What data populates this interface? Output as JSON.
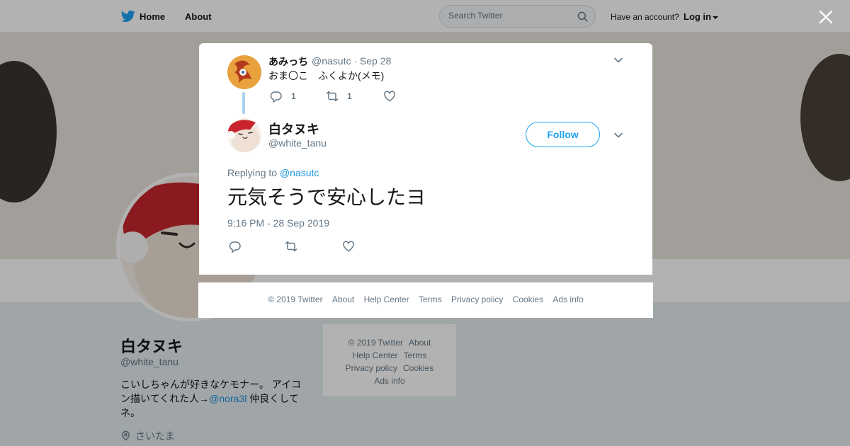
{
  "topbar": {
    "home_label": "Home",
    "about_label": "About",
    "search_placeholder": "Search Twitter",
    "have_account": "Have an account?",
    "login_label": "Log in"
  },
  "profile": {
    "name": "白タヌキ",
    "handle": "@white_tanu",
    "bio_before": "こいしちゃんが好きなケモナー。 アイコン描いてくれた人→",
    "bio_link": "@nora3l",
    "bio_after": " 仲良くしてネ。",
    "location": "さいたま"
  },
  "side_footer": {
    "copyright": "© 2019 Twitter",
    "about": "About",
    "help_center": "Help Center",
    "terms": "Terms",
    "privacy": "Privacy policy",
    "cookies": "Cookies",
    "ads_info": "Ads info"
  },
  "context_tweet": {
    "name": "あみっち",
    "handle_date": "@nasutc · Sep 28",
    "text": "おま〇こ　ふくよか(メモ)",
    "reply_count": "1",
    "retweet_count": "1"
  },
  "main_tweet": {
    "name": "白タヌキ",
    "handle": "@white_tanu",
    "follow_label": "Follow",
    "replying_prefix": "Replying to ",
    "replying_to": "@nasutc",
    "text": "元気そうで安心したヨ",
    "time": "9:16 PM - 28 Sep 2019"
  },
  "modal_footer": {
    "copyright": "© 2019 Twitter",
    "about": "About",
    "help_center": "Help Center",
    "terms": "Terms",
    "privacy": "Privacy policy",
    "cookies": "Cookies",
    "ads_info": "Ads info"
  },
  "colors": {
    "brand": "#1da1f2",
    "link": "#1b95e0",
    "muted": "#657786",
    "thread_line": "#aad1ee"
  },
  "icons": [
    "twitter-bird-icon",
    "search-icon",
    "close-icon",
    "chevron-down-icon",
    "reply-icon",
    "retweet-icon",
    "like-icon",
    "location-pin-icon"
  ]
}
